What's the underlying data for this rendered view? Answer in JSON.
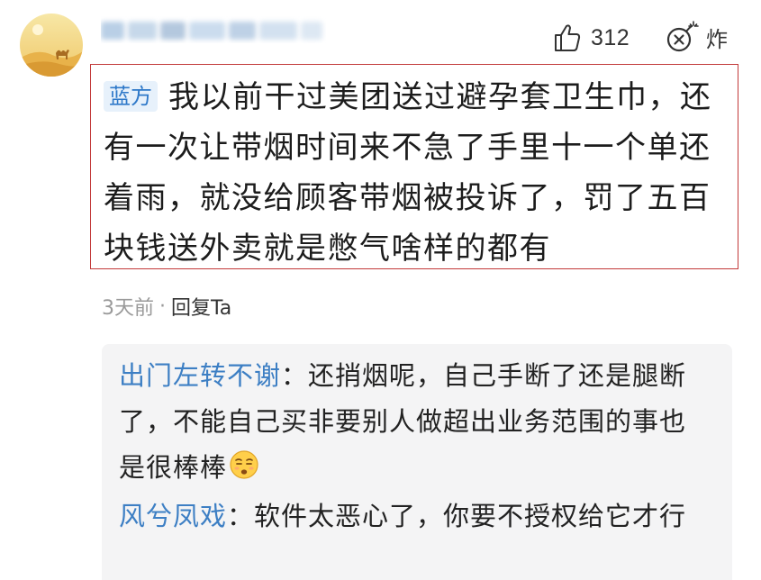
{
  "comment": {
    "likes": "312",
    "bomb_label": "炸",
    "stance_badge": "蓝方",
    "text": "我以前干过美团送过避孕套卫生巾，还有一次让带烟时间来不急了手里十一个单还着雨，就没给顾客带烟被投诉了，罚了五百块钱送外卖就是憋气啥样的都有",
    "time": "3天前",
    "separator": "·",
    "reply_label": "回复Ta"
  },
  "replies": [
    {
      "author": "出门左转不谢",
      "colon": "：",
      "text": "还捎烟呢，自己手断了还是腿断了，不能自己买非要别人做超出业务范围的事也是很棒棒",
      "emoji": "unamused-face-emoji"
    },
    {
      "author": "风兮凤戏",
      "colon": "：",
      "text": "软件太恶心了，你要不授权给它才行"
    }
  ],
  "colors": {
    "highlight_border": "#c23a3a",
    "link_blue": "#3d7fc4",
    "badge_bg": "#e7f1fb",
    "badge_text": "#2f79c9",
    "panel_bg": "#f4f4f5",
    "muted_text": "#9a9a9a"
  },
  "icons": {
    "like": "thumbs-up-icon",
    "bomb": "bomb-icon",
    "avatar": "desert-camel-avatar"
  }
}
